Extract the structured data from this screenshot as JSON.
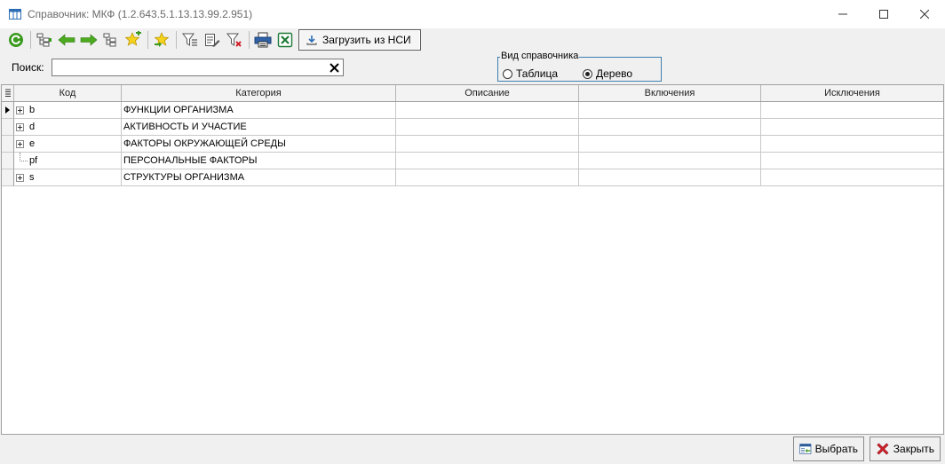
{
  "window": {
    "title": "Справочник: МКФ (1.2.643.5.1.13.13.99.2.951)"
  },
  "toolbar": {
    "load_label": "Загрузить из НСИ"
  },
  "search": {
    "label": "Поиск:",
    "value": "",
    "placeholder": ""
  },
  "view_group": {
    "legend": "Вид справочника",
    "options": [
      {
        "label": "Таблица",
        "selected": false
      },
      {
        "label": "Дерево",
        "selected": true
      }
    ]
  },
  "grid": {
    "columns": [
      "Код",
      "Категория",
      "Описание",
      "Включения",
      "Исключения"
    ],
    "rows": [
      {
        "code": "b",
        "category": "ФУНКЦИИ ОРГАНИЗМА",
        "description": "",
        "includes": "",
        "excludes": "",
        "expandable": true,
        "current": true
      },
      {
        "code": "d",
        "category": "АКТИВНОСТЬ И УЧАСТИЕ",
        "description": "",
        "includes": "",
        "excludes": "",
        "expandable": true,
        "current": false
      },
      {
        "code": "e",
        "category": "ФАКТОРЫ ОКРУЖАЮЩЕЙ СРЕДЫ",
        "description": "",
        "includes": "",
        "excludes": "",
        "expandable": true,
        "current": false
      },
      {
        "code": "pf",
        "category": "ПЕРСОНАЛЬНЫЕ ФАКТОРЫ",
        "description": "",
        "includes": "",
        "excludes": "",
        "expandable": false,
        "current": false
      },
      {
        "code": "s",
        "category": "СТРУКТУРЫ ОРГАНИЗМА",
        "description": "",
        "includes": "",
        "excludes": "",
        "expandable": true,
        "current": false
      }
    ]
  },
  "footer": {
    "select_label": "Выбрать",
    "close_label": "Закрыть"
  },
  "colors": {
    "accent_green": "#3a9a1e",
    "group_border": "#3c7fb1",
    "close_red": "#d0202a"
  }
}
